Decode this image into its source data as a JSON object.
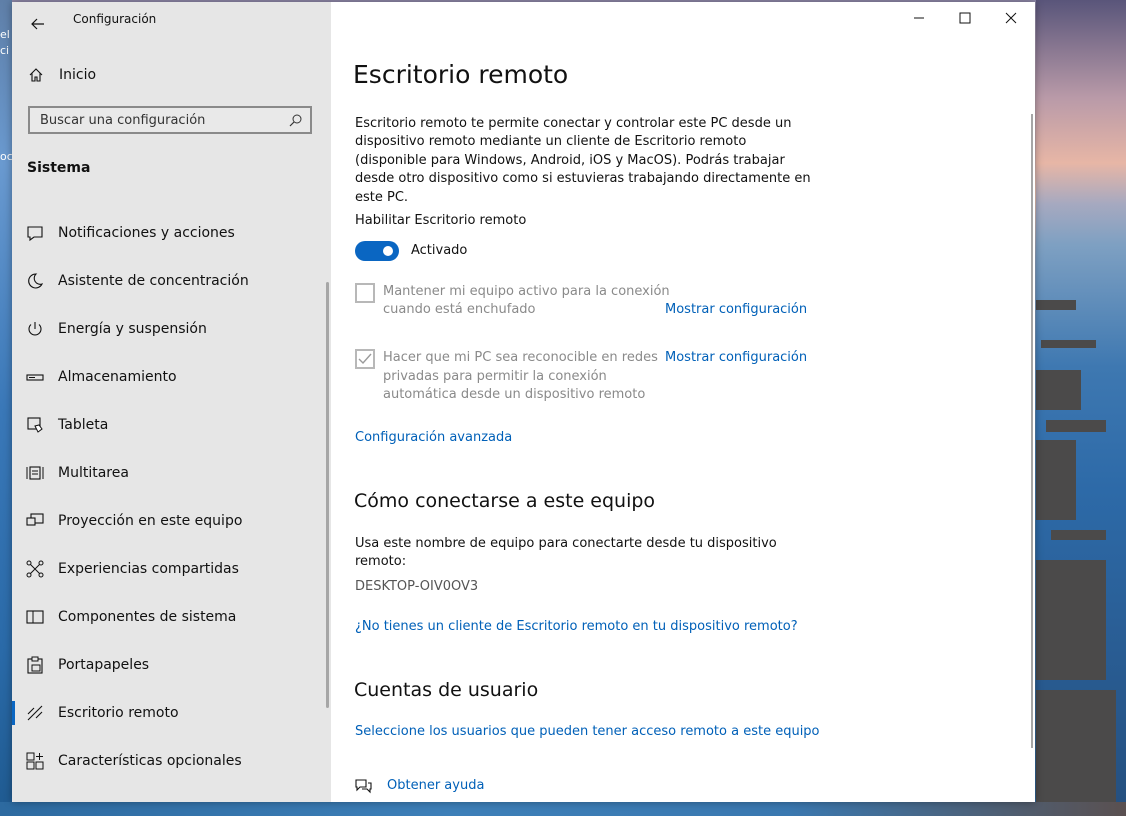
{
  "desktop": {
    "frag1": "el",
    "frag2": "ci",
    "frag3": "oc"
  },
  "window": {
    "title": "Configuración"
  },
  "sidebar": {
    "home_label": "Inicio",
    "search_placeholder": "Buscar una configuración",
    "section_title": "Sistema",
    "items": [
      {
        "label": "Notificaciones y acciones",
        "icon": "notification-icon"
      },
      {
        "label": "Asistente de concentración",
        "icon": "moon-icon"
      },
      {
        "label": "Energía y suspensión",
        "icon": "power-icon"
      },
      {
        "label": "Almacenamiento",
        "icon": "storage-icon"
      },
      {
        "label": "Tableta",
        "icon": "tablet-icon"
      },
      {
        "label": "Multitarea",
        "icon": "multitask-icon"
      },
      {
        "label": "Proyección en este equipo",
        "icon": "projection-icon"
      },
      {
        "label": "Experiencias compartidas",
        "icon": "shared-icon"
      },
      {
        "label": "Componentes de sistema",
        "icon": "components-icon"
      },
      {
        "label": "Portapapeles",
        "icon": "clipboard-icon"
      },
      {
        "label": "Escritorio remoto",
        "icon": "remote-desktop-icon",
        "active": true
      },
      {
        "label": "Características opcionales",
        "icon": "optional-features-icon"
      }
    ]
  },
  "main": {
    "title": "Escritorio remoto",
    "description": "Escritorio remoto te permite conectar y controlar este PC desde un dispositivo remoto mediante un cliente de Escritorio remoto (disponible para Windows, Android, iOS y MacOS). Podrás trabajar desde otro dispositivo como si estuvieras trabajando directamente en este PC.",
    "enable_label": "Habilitar Escritorio remoto",
    "toggle_state": "Activado",
    "toggle_on": true,
    "option1_line1": "Mantener mi equipo activo para la conexión",
    "option1_line2": "cuando está enchufado",
    "option1_checked": false,
    "option2_line1": "Hacer que mi PC sea reconocible en redes",
    "option2_line2": "privadas para permitir la conexión",
    "option2_line3": "automática desde un dispositivo remoto",
    "option2_checked": true,
    "show_settings_label": "Mostrar configuración",
    "advanced_link": "Configuración avanzada",
    "connect_heading": "Cómo conectarse a este equipo",
    "connect_desc_line1": "Usa este nombre de equipo para conectarte desde tu dispositivo",
    "connect_desc_line2": "remoto:",
    "pc_name": "DESKTOP-OIV0OV3",
    "no_client_link": "¿No tienes un cliente de Escritorio remoto en tu dispositivo remoto?",
    "accounts_heading": "Cuentas de usuario",
    "select_users_link": "Seleccione los usuarios que pueden tener acceso remoto a este equipo",
    "help_link": "Obtener ayuda"
  },
  "colors": {
    "accent": "#0a66c2",
    "link": "#0060b8",
    "sidebar_bg": "#e6e6e6"
  }
}
